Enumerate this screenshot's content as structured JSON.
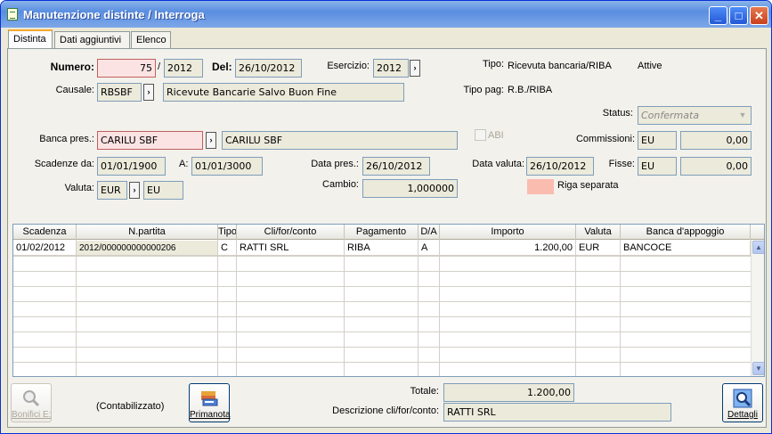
{
  "window": {
    "title": "Manutenzione distinte / Interroga",
    "min": "_",
    "max": "□",
    "close": "✕"
  },
  "tabs": [
    "Distinta",
    "Dati aggiuntivi",
    "Elenco"
  ],
  "form": {
    "numero_label": "Numero:",
    "numero": "75",
    "slash": "/",
    "anno": "2012",
    "del_label": "Del:",
    "del": "26/10/2012",
    "esercizio_label": "Esercizio:",
    "esercizio": "2012",
    "tipo_label": "Tipo:",
    "tipo": "Ricevuta bancaria/RIBA",
    "attive": "Attive",
    "causale_label": "Causale:",
    "causale": "RBSBF",
    "causale_desc": "Ricevute Bancarie Salvo Buon Fine",
    "tipopag_label": "Tipo pag:",
    "tipopag": "R.B./RIBA",
    "status_label": "Status:",
    "status": "Confermata",
    "banca_label": "Banca pres.:",
    "banca": "CARILU SBF",
    "banca_desc": "CARILU SBF",
    "abi_label": "ABI",
    "commissioni_label": "Commissioni:",
    "commissioni_val": "EU",
    "commissioni_amt": "0,00",
    "scadenze_label": "Scadenze da:",
    "scadenze_da": "01/01/1900",
    "a_label": "A:",
    "scadenze_a": "01/01/3000",
    "datapres_label": "Data pres.:",
    "datapres": "26/10/2012",
    "datavaluta_label": "Data valuta:",
    "datavaluta": "26/10/2012",
    "fisse_label": "Fisse:",
    "fisse_val": "EU",
    "fisse_amt": "0,00",
    "valuta_label": "Valuta:",
    "valuta": "EUR",
    "valuta_desc": "EU",
    "cambio_label": "Cambio:",
    "cambio": "1,000000",
    "riga_label": "Riga separata"
  },
  "grid": {
    "headers": [
      "Scadenza",
      "N.partita",
      "Tipo",
      "Cli/for/conto",
      "Pagamento",
      "D/A",
      "Importo",
      "Valuta",
      "Banca d'appoggio"
    ],
    "rows": [
      [
        "01/02/2012",
        "2012/000000000000206",
        "C",
        "RATTI SRL",
        "RIBA",
        "A",
        "1.200,00",
        "EUR",
        "BANCOCE"
      ]
    ]
  },
  "footer": {
    "bonifici_label": "Bonifici E:",
    "contabilizzato": "(Contabilizzato)",
    "primanota_label": "Primanota",
    "totale_label": "Totale:",
    "totale": "1.200,00",
    "descr_label": "Descrizione cli/for/conto:",
    "descr": "RATTI SRL",
    "dettagli_label": "Dettagli"
  },
  "colors": {
    "accent": "#f7a832",
    "highlight": "#fbbcb0",
    "title": "#5a8ee0"
  }
}
